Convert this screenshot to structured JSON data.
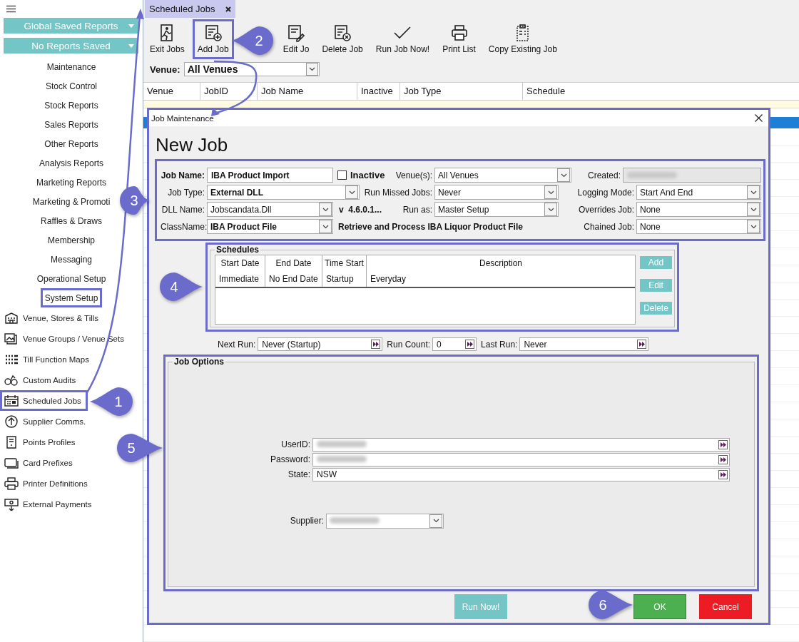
{
  "sidebar": {
    "saved_reports": [
      {
        "label": "Global Saved Reports"
      },
      {
        "label": "No Reports Saved"
      }
    ],
    "sections": [
      {
        "label": "Maintenance",
        "highlighted": false
      },
      {
        "label": "Stock Control",
        "highlighted": false
      },
      {
        "label": "Stock Reports",
        "highlighted": false
      },
      {
        "label": "Sales Reports",
        "highlighted": false
      },
      {
        "label": "Other Reports",
        "highlighted": false
      },
      {
        "label": "Analysis Reports",
        "highlighted": false
      },
      {
        "label": "Marketing Reports",
        "highlighted": false
      },
      {
        "label": "Marketing & Promoti",
        "highlighted": false
      },
      {
        "label": "Raffles & Draws",
        "highlighted": false
      },
      {
        "label": "Membership",
        "highlighted": false
      },
      {
        "label": "Messaging",
        "highlighted": false
      },
      {
        "label": "Operational Setup",
        "highlighted": false
      },
      {
        "label": "System Setup",
        "highlighted": true
      }
    ],
    "tools": [
      {
        "label": "Venue, Stores & Tills",
        "highlighted": false
      },
      {
        "label": "Venue Groups / Venue Sets",
        "highlighted": false
      },
      {
        "label": "Till Function Maps",
        "highlighted": false
      },
      {
        "label": "Custom Audits",
        "highlighted": false
      },
      {
        "label": "Scheduled Jobs",
        "highlighted": true
      },
      {
        "label": "Supplier Comms.",
        "highlighted": false
      },
      {
        "label": "Points Profiles",
        "highlighted": false
      },
      {
        "label": "Card Prefixes",
        "highlighted": false
      },
      {
        "label": "Printer Definitions",
        "highlighted": false
      },
      {
        "label": "External Payments",
        "highlighted": false
      }
    ]
  },
  "tabs": [
    {
      "label": "Scheduled Jobs",
      "selected": true
    }
  ],
  "toolbar": [
    {
      "label": "Exit Jobs",
      "highlighted": false
    },
    {
      "label": "Add Job",
      "highlighted": true
    },
    {
      "label": "Edit Jo",
      "highlighted": false
    },
    {
      "label": "Delete Job",
      "highlighted": false
    },
    {
      "label": "Run Job Now!",
      "highlighted": false
    },
    {
      "label": "Print List",
      "highlighted": false
    },
    {
      "label": "Copy Existing Job",
      "highlighted": false
    }
  ],
  "venue_filter": {
    "label": "Venue:",
    "value": "All Venues"
  },
  "grid": {
    "columns": [
      "Venue",
      "JobID",
      "Job Name",
      "Inactive",
      "Job Type",
      "Schedule"
    ]
  },
  "dialog": {
    "title": "Job Maintenance",
    "heading": "New Job",
    "form": {
      "job_name": {
        "label": "Job Name:",
        "value": "IBA Product Import"
      },
      "inactive": {
        "label": "Inactive",
        "checked": false
      },
      "venues": {
        "label": "Venue(s):",
        "value": "All Venues"
      },
      "created": {
        "label": "Created:"
      },
      "job_type": {
        "label": "Job Type:",
        "value": "External DLL"
      },
      "run_missed_jobs": {
        "label": "Run Missed Jobs:",
        "value": "Never"
      },
      "logging_mode": {
        "label": "Logging Mode:",
        "value": "Start And End"
      },
      "dll_name": {
        "label": "DLL Name:",
        "value": "Jobscandata.Dll"
      },
      "dll_version": "v  4.6.0.1...",
      "run_as": {
        "label": "Run as:",
        "value": "Master Setup"
      },
      "overrides_job": {
        "label": "Overrides Job:",
        "value": "None"
      },
      "class_name": {
        "label": "ClassName:",
        "value": "IBA Product File"
      },
      "class_description": "Retrieve and Process IBA Liquor Product File",
      "chained_job": {
        "label": "Chained Job:",
        "value": "None"
      }
    },
    "schedules": {
      "title": "Schedules",
      "columns": [
        "Start Date",
        "End Date",
        "Time Start",
        "Description"
      ],
      "rows": [
        [
          "Immediate",
          "No End Date",
          "Startup",
          "Everyday"
        ]
      ],
      "buttons": [
        "Add",
        "Edit",
        "Delete"
      ]
    },
    "run_info": [
      {
        "label": "Next Run:",
        "value": "Never (Startup)"
      },
      {
        "label": "Run Count:",
        "value": "0"
      },
      {
        "label": "Last Run:",
        "value": "Never"
      }
    ],
    "job_options": {
      "title": "Job Options",
      "fields": [
        {
          "label": "UserID:",
          "kind": "text"
        },
        {
          "label": "Password:",
          "kind": "text"
        },
        {
          "label": "State:",
          "kind": "text",
          "value": "NSW"
        },
        {
          "label": "Supplier:",
          "kind": "select"
        }
      ]
    },
    "buttons": [
      {
        "label": "Run Now!",
        "kind": "run"
      },
      {
        "label": "OK",
        "kind": "ok"
      },
      {
        "label": "Cancel",
        "kind": "cancel"
      }
    ]
  },
  "callouts": [
    "1",
    "2",
    "3",
    "4",
    "5",
    "6"
  ]
}
